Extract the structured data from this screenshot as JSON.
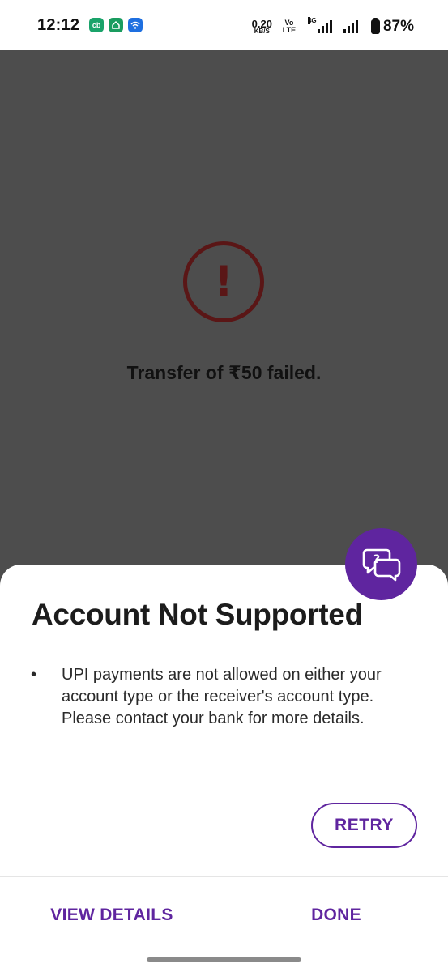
{
  "status_bar": {
    "time": "12:12",
    "notifications": [
      "cb",
      "home-app",
      "wifi-app"
    ],
    "speed_value": "0.20",
    "speed_unit": "KB/S",
    "volte": "Vo LTE",
    "network": "4G",
    "battery_percent": "87%"
  },
  "background": {
    "alert_icon": "exclamation-circle-icon",
    "message": "Transfer of ₹50 failed."
  },
  "sheet": {
    "help_icon": "chat-question-icon",
    "title": "Account Not Supported",
    "bullet": "UPI payments are not allowed on either your account type or the receiver's account type.",
    "bullet_line2": "Please contact your bank for more details.",
    "retry_label": "RETRY",
    "view_details_label": "VIEW DETAILS",
    "done_label": "DONE"
  },
  "colors": {
    "accent": "#5f259f",
    "error_dim": "#5a1616",
    "overlay": "#4d4d4d"
  }
}
